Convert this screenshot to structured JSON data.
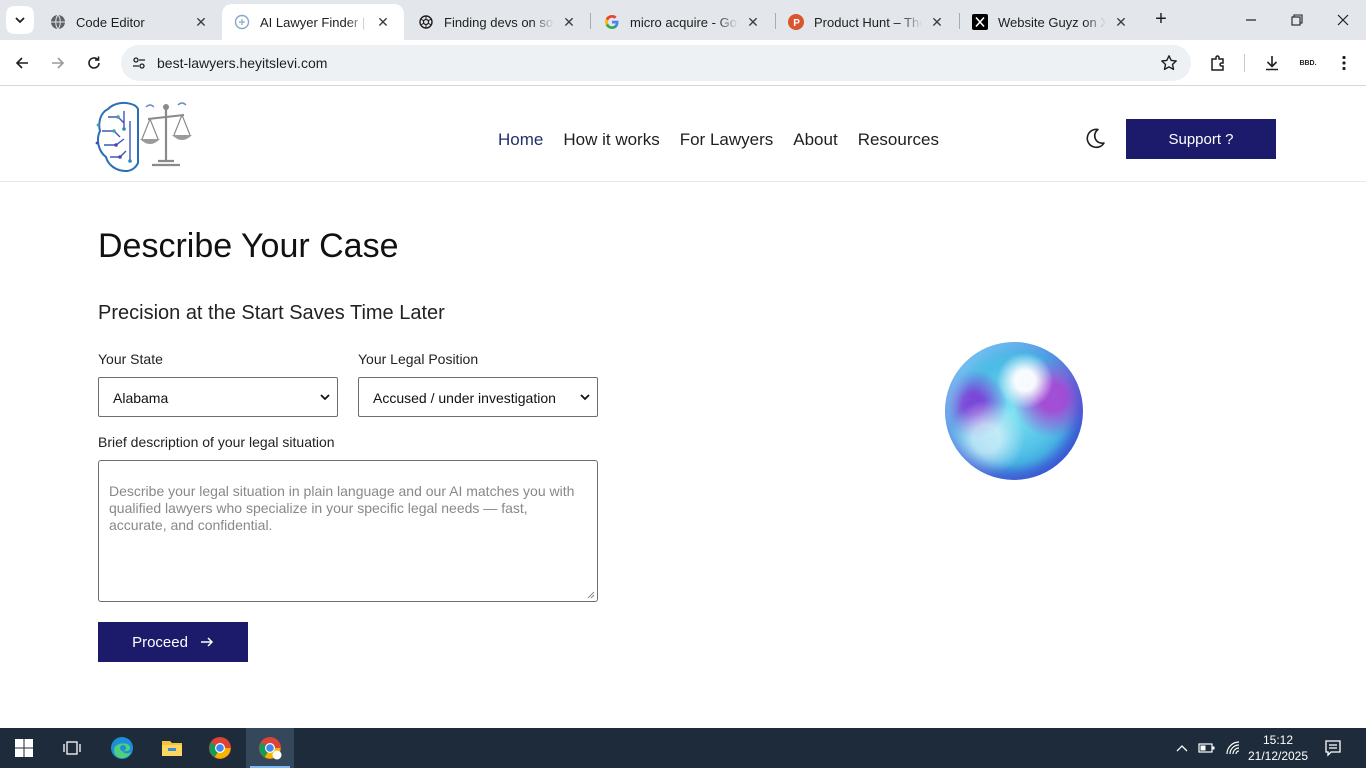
{
  "browser": {
    "tabs": [
      {
        "title": "Code Editor",
        "active": false
      },
      {
        "title": "AI Lawyer Finder | Ma",
        "active": true
      },
      {
        "title": "Finding devs on socia",
        "active": false
      },
      {
        "title": "micro acquire - Goog",
        "active": false
      },
      {
        "title": "Product Hunt – The b",
        "active": false
      },
      {
        "title": "Website Guyz on X: \"",
        "active": false
      }
    ],
    "url": "best-lawyers.heyitslevi.com",
    "profile_label": "BBD."
  },
  "site": {
    "nav": [
      {
        "label": "Home",
        "active": true
      },
      {
        "label": "How it works",
        "active": false
      },
      {
        "label": "For Lawyers",
        "active": false
      },
      {
        "label": "About",
        "active": false
      },
      {
        "label": "Resources",
        "active": false
      }
    ],
    "support_label": "Support ?",
    "brand_color": "#1b1a6b"
  },
  "form": {
    "title": "Describe Your Case",
    "subtitle": "Precision at the Start Saves Time Later",
    "state_label": "Your State",
    "state_value": "Alabama",
    "position_label": "Your Legal Position",
    "position_value": "Accused / under investigation",
    "description_label": "Brief description of your legal situation",
    "description_placeholder": "Describe your legal situation in plain language and our AI matches you with qualified lawyers who specialize in your specific legal needs — fast, accurate, and confidential.",
    "proceed_label": "Proceed"
  },
  "taskbar": {
    "time": "15:12",
    "date": "21/12/2025"
  }
}
